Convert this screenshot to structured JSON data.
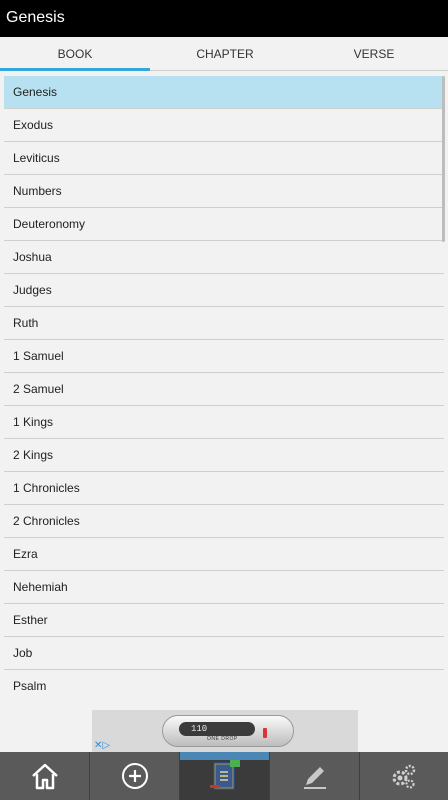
{
  "header": {
    "title": "Genesis"
  },
  "tabs": [
    {
      "label": "BOOK",
      "active": true
    },
    {
      "label": "CHAPTER",
      "active": false
    },
    {
      "label": "VERSE",
      "active": false
    }
  ],
  "books": [
    {
      "name": "Genesis",
      "selected": true
    },
    {
      "name": "Exodus"
    },
    {
      "name": "Leviticus"
    },
    {
      "name": "Numbers"
    },
    {
      "name": "Deuteronomy"
    },
    {
      "name": "Joshua"
    },
    {
      "name": "Judges"
    },
    {
      "name": "Ruth"
    },
    {
      "name": "1 Samuel"
    },
    {
      "name": "2 Samuel"
    },
    {
      "name": "1 Kings"
    },
    {
      "name": "2 Kings"
    },
    {
      "name": "1 Chronicles"
    },
    {
      "name": "2 Chronicles"
    },
    {
      "name": "Ezra"
    },
    {
      "name": "Nehemiah"
    },
    {
      "name": "Esther"
    },
    {
      "name": "Job"
    },
    {
      "name": "Psalm"
    }
  ],
  "ad": {
    "screen_text": "110",
    "brand_text": "ONE DROP"
  },
  "bottom_nav": [
    {
      "icon": "home-icon"
    },
    {
      "icon": "add-circle-icon"
    },
    {
      "icon": "holy-bible-icon",
      "active": true
    },
    {
      "icon": "pencil-icon"
    },
    {
      "icon": "settings-gears-icon"
    }
  ],
  "colors": {
    "accent": "#33a7db",
    "selected_row": "#b7e1f0",
    "titlebar": "#000000",
    "bottombar": "#5a5a5a"
  }
}
